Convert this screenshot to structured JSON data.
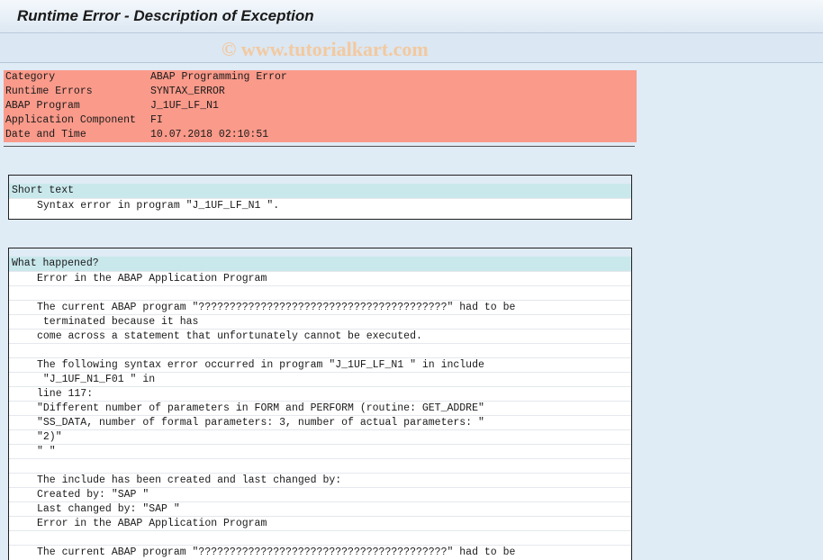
{
  "window": {
    "title": "Runtime Error - Description of Exception"
  },
  "watermark": "© www.tutorialkart.com",
  "header": {
    "rows": [
      {
        "label": "Category",
        "value": "ABAP Programming Error"
      },
      {
        "label": "Runtime Errors",
        "value": "SYNTAX_ERROR"
      },
      {
        "label": "ABAP Program",
        "value": "J_1UF_LF_N1"
      },
      {
        "label": "Application Component",
        "value": "FI"
      },
      {
        "label": "Date and Time",
        "value": "10.07.2018 02:10:51"
      }
    ]
  },
  "short_text": {
    "heading": "Short text",
    "lines": [
      "Syntax error in program \"J_1UF_LF_N1 \"."
    ]
  },
  "what_happened": {
    "heading": "What happened?",
    "lines": [
      "Error in the ABAP Application Program",
      "",
      "The current ABAP program \"????????????????????????????????????????\" had to be",
      " terminated because it has",
      "come across a statement that unfortunately cannot be executed.",
      "",
      "The following syntax error occurred in program \"J_1UF_LF_N1 \" in include",
      " \"J_1UF_N1_F01 \" in",
      "line 117:",
      "\"Different number of parameters in FORM and PERFORM (routine: GET_ADDRE\"",
      "\"SS_DATA, number of formal parameters: 3, number of actual parameters: \"",
      "\"2)\"",
      "\" \"",
      "",
      "The include has been created and last changed by:",
      "Created by: \"SAP \"",
      "Last changed by: \"SAP \"",
      "Error in the ABAP Application Program",
      "",
      "The current ABAP program \"????????????????????????????????????????\" had to be"
    ]
  }
}
